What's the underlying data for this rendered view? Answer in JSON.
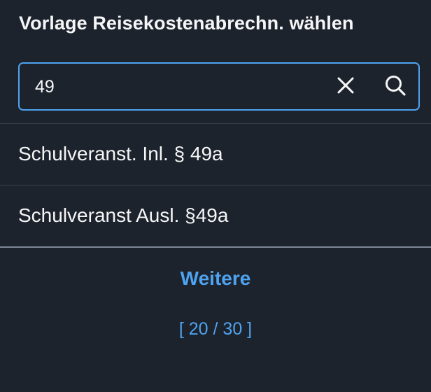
{
  "dialog": {
    "title": "Vorlage Reisekostenabrechn. wählen"
  },
  "search": {
    "value": "49",
    "clear_icon": "close-icon",
    "search_icon": "search-icon"
  },
  "list": {
    "items": [
      {
        "label": "Schulveranst. Inl. § 49a"
      },
      {
        "label": "Schulveranst Ausl. §49a"
      }
    ]
  },
  "more": {
    "label": "Weitere",
    "count": "[ 20 / 30 ]"
  },
  "colors": {
    "background": "#1d232c",
    "accent": "#4ea3f0",
    "text": "#f5f6f7"
  }
}
